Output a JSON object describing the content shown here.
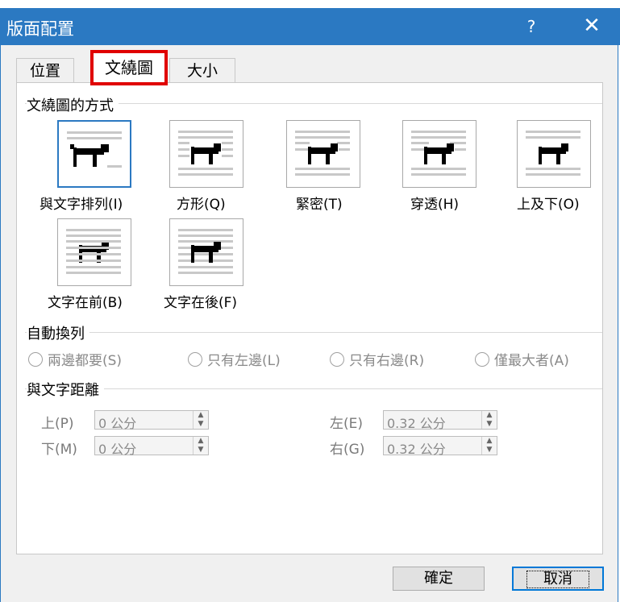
{
  "title": "版面配置",
  "help_glyph": "?",
  "close_glyph": "✕",
  "tabs": [
    "位置",
    "文繞圖",
    "大小"
  ],
  "wrap_style_group": "文繞圖的方式",
  "wrap_styles": [
    "與文字排列(I)",
    "方形(Q)",
    "緊密(T)",
    "穿透(H)",
    "上及下(O)",
    "文字在前(B)",
    "文字在後(F)"
  ],
  "auto_wrap_group": "自動換列",
  "auto_wrap_options": [
    "兩邊都要(S)",
    "只有左邊(L)",
    "只有右邊(R)",
    "僅最大者(A)"
  ],
  "distance_group": "與文字距離",
  "distance": {
    "top_label": "上(P)",
    "top_value": "0 公分",
    "bottom_label": "下(M)",
    "bottom_value": "0 公分",
    "left_label": "左(E)",
    "left_value": "0.32 公分",
    "right_label": "右(G)",
    "right_value": "0.32 公分"
  },
  "buttons": {
    "ok": "確定",
    "cancel": "取消"
  },
  "colors": {
    "titlebar": "#2b79c2",
    "highlight": "#e00000"
  }
}
